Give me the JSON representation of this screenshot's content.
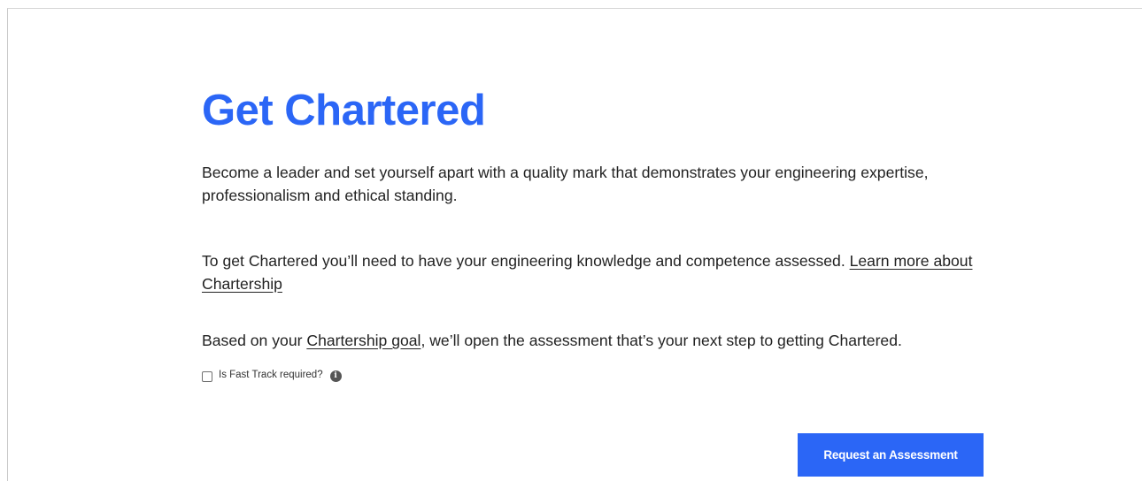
{
  "hero": {
    "title": "Get Chartered",
    "intro": "Become a leader and set yourself apart with a quality mark that demonstrates your engineering expertise, professionalism and ethical standing.",
    "assessment_text": "To get Chartered you’ll need to have your engineering knowledge and competence assessed. ",
    "learn_more_link": "Learn more about Chartership",
    "goal_text_before": "Based on your ",
    "goal_link": "Chartership goal",
    "goal_text_after": ", we’ll open the assessment that’s your next step to getting Chartered."
  },
  "fast_track": {
    "label": "Is Fast Track required?",
    "checked": false,
    "info_icon": "info-icon",
    "info_glyph": "i"
  },
  "cta": {
    "label": "Request an Assessment"
  },
  "colors": {
    "accent": "#2b66f6",
    "text": "#222222",
    "background": "#ffffff"
  }
}
